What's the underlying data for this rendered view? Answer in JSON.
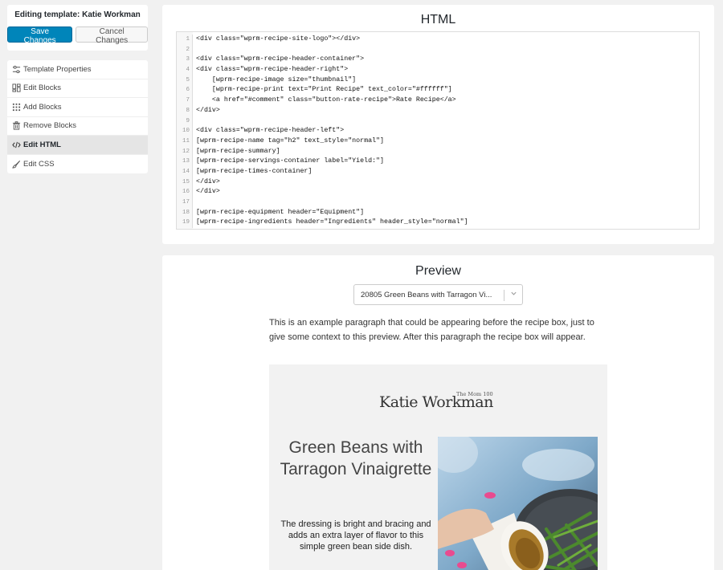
{
  "sidebar": {
    "editing_label": "Editing template: Katie Workman",
    "save_label": "Save Changes",
    "cancel_label": "Cancel Changes",
    "menu": [
      {
        "label": "Template Properties",
        "icon": "sliders-icon"
      },
      {
        "label": "Edit Blocks",
        "icon": "blocks-grid-icon"
      },
      {
        "label": "Add Blocks",
        "icon": "add-blocks-icon"
      },
      {
        "label": "Remove Blocks",
        "icon": "trash-icon"
      },
      {
        "label": "Edit HTML",
        "icon": "code-icon",
        "active": true
      },
      {
        "label": "Edit CSS",
        "icon": "brush-icon"
      }
    ]
  },
  "html_panel": {
    "title": "HTML",
    "lines": [
      {
        "n": "1",
        "code": "<div class=\"wprm-recipe-site-logo\"></div>"
      },
      {
        "n": "2",
        "code": ""
      },
      {
        "n": "3",
        "code": "<div class=\"wprm-recipe-header-container\">"
      },
      {
        "n": "4",
        "code": "<div class=\"wprm-recipe-header-right\">"
      },
      {
        "n": "5",
        "code": "    [wprm-recipe-image size=\"thumbnail\"]"
      },
      {
        "n": "6",
        "code": "    [wprm-recipe-print text=\"Print Recipe\" text_color=\"#ffffff\"]"
      },
      {
        "n": "7",
        "code": "    <a href=\"#comment\" class=\"button-rate-recipe\">Rate Recipe</a>"
      },
      {
        "n": "8",
        "code": "</div>"
      },
      {
        "n": "9",
        "code": ""
      },
      {
        "n": "10",
        "code": "<div class=\"wprm-recipe-header-left\">"
      },
      {
        "n": "11",
        "code": "[wprm-recipe-name tag=\"h2\" text_style=\"normal\"]"
      },
      {
        "n": "12",
        "code": "[wprm-recipe-summary]"
      },
      {
        "n": "13",
        "code": "[wprm-recipe-servings-container label=\"Yield:\"]"
      },
      {
        "n": "14",
        "code": "[wprm-recipe-times-container]"
      },
      {
        "n": "15",
        "code": "</div>"
      },
      {
        "n": "16",
        "code": "</div>"
      },
      {
        "n": "17",
        "code": ""
      },
      {
        "n": "18",
        "code": "[wprm-recipe-equipment header=\"Equipment\"]"
      },
      {
        "n": "19",
        "code": "[wprm-recipe-ingredients header=\"Ingredients\" header_style=\"normal\"]"
      }
    ]
  },
  "preview_panel": {
    "title": "Preview",
    "select_value": "20805 Green Beans with Tarragon Vi...",
    "intro": "This is an example paragraph that could be appearing before the recipe box, just to give some context to this preview. After this paragraph the recipe box will appear.",
    "logo_main": "Katie Workman",
    "logo_sub": "The Mom 100",
    "recipe_title": "Green Beans with Tarragon Vinaigrette",
    "recipe_summary": "The dressing is bright and bracing and adds an extra layer of flavor to this simple green bean side dish."
  }
}
